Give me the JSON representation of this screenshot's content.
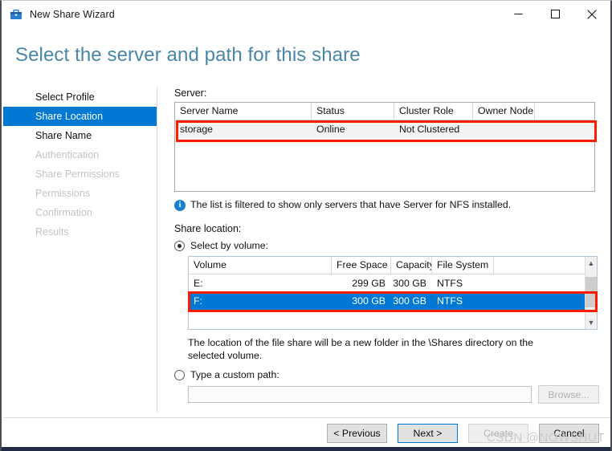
{
  "window": {
    "title": "New Share Wizard",
    "icon": "toolbox-icon",
    "controls": {
      "minimize": "minimize-icon",
      "maximize": "maximize-icon",
      "close": "close-icon"
    }
  },
  "heading": "Select the server and path for this share",
  "sidebar": {
    "items": [
      {
        "label": "Select Profile",
        "state": "enabled"
      },
      {
        "label": "Share Location",
        "state": "selected"
      },
      {
        "label": "Share Name",
        "state": "enabled"
      },
      {
        "label": "Authentication",
        "state": "disabled"
      },
      {
        "label": "Share Permissions",
        "state": "disabled"
      },
      {
        "label": "Permissions",
        "state": "disabled"
      },
      {
        "label": "Confirmation",
        "state": "disabled"
      },
      {
        "label": "Results",
        "state": "disabled"
      }
    ]
  },
  "server_section": {
    "label": "Server:",
    "columns": [
      "Server Name",
      "Status",
      "Cluster Role",
      "Owner Node",
      ""
    ],
    "rows": [
      {
        "server_name": "storage",
        "status": "Online",
        "cluster_role": "Not Clustered",
        "owner_node": "",
        "extra": "",
        "selected": true
      }
    ],
    "info_icon": "info-icon",
    "info_text": "The list is filtered to show only servers that have Server for NFS installed."
  },
  "share_location": {
    "label": "Share location:",
    "select_by_volume": {
      "label": "Select by volume:",
      "checked": true
    },
    "volume_table": {
      "columns": [
        "Volume",
        "Free Space",
        "Capacity",
        "File System",
        ""
      ],
      "rows": [
        {
          "volume": "E:",
          "free_space": "299 GB",
          "capacity": "300 GB",
          "file_system": "NTFS",
          "extra": "",
          "selected": false
        },
        {
          "volume": "F:",
          "free_space": "300 GB",
          "capacity": "300 GB",
          "file_system": "NTFS",
          "extra": "",
          "selected": true
        }
      ],
      "scroll_up_icon": "chevron-up-icon",
      "scroll_down_icon": "chevron-down-icon"
    },
    "note": "The location of the file share will be a new folder in the \\Shares directory on the selected volume.",
    "custom_path": {
      "label": "Type a custom path:",
      "checked": false,
      "input_value": "",
      "input_placeholder": "",
      "browse_label": "Browse..."
    }
  },
  "footer": {
    "previous_label": "< Previous",
    "next_label": "Next >",
    "create_label": "Create",
    "cancel_label": "Cancel"
  },
  "watermark": "CSDN @NOWSHUT",
  "colors": {
    "accent": "#0078d4",
    "heading": "#4886a8",
    "annotation": "#ff1a00",
    "info": "#1a7fd4"
  }
}
